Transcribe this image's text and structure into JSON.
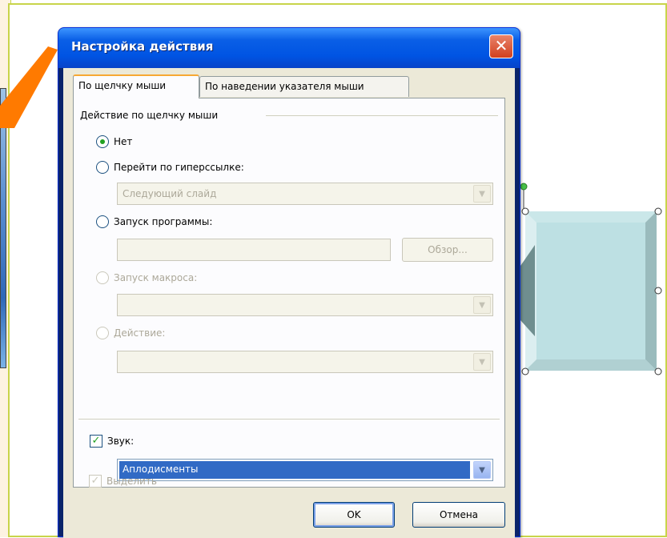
{
  "dialog": {
    "title": "Настройка действия",
    "close_glyph": "✕"
  },
  "tabs": [
    {
      "label": "По щелчку мыши",
      "active": true
    },
    {
      "label": "По наведении указателя мыши",
      "active": false
    }
  ],
  "group": {
    "label": "Действие по щелчку мыши"
  },
  "options": {
    "none": {
      "label": "Нет",
      "checked": true
    },
    "hyperlink": {
      "label": "Перейти по гиперссылке:",
      "checked": false
    },
    "hyperlink_value": "Следующий слайд",
    "program": {
      "label": "Запуск программы:",
      "checked": false
    },
    "program_value": "",
    "browse_label": "Обзор...",
    "macro": {
      "label": "Запуск макроса:",
      "checked": false
    },
    "macro_value": "",
    "action": {
      "label": "Действие:",
      "checked": false
    },
    "action_value": ""
  },
  "sound": {
    "label": "Звук:",
    "checked": true,
    "value": "Аплодисменты"
  },
  "highlight": {
    "label": "Выделить",
    "checked": true
  },
  "buttons": {
    "ok": "OK",
    "cancel": "Отмена"
  },
  "colors": {
    "titlebar": "#0054e3",
    "accent_orange": "#ff7a00",
    "shape_fill": "#bde0e3",
    "shape_dark": "#6f8e8f"
  },
  "icons": {
    "close": "close-icon",
    "dropdown": "chevron-down-icon",
    "check": "check-icon"
  }
}
